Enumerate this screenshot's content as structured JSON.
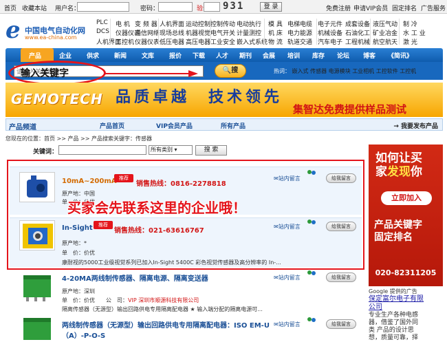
{
  "topbar": {
    "home": "首页",
    "favorite": "收藏本站",
    "username_label": "用户名：",
    "password_label": "密码：",
    "captcha_label": "验证码：",
    "captcha_value": "931",
    "login": "登 录",
    "links": [
      "免费注册",
      "申请VIP会员",
      "固定排名",
      "广告服务"
    ]
  },
  "logo": {
    "mark": "e",
    "name": "中国电气自动化网",
    "url": "www.ea-china.com"
  },
  "categories": {
    "col1": [
      "PLC",
      "DCS",
      "人机界面"
    ],
    "col2": [
      "电 机",
      "仪器仪表",
      "工控机"
    ],
    "col3": [
      "变 频 器",
      "通信网络",
      "仪器仪表"
    ],
    "col4": [
      "人机界面",
      "现场总线",
      "低压电器"
    ],
    "col5": [
      "运动控制",
      "机器视觉",
      "高压电器"
    ],
    "col6": [
      "控制传动",
      "电气开关",
      "工业安全"
    ],
    "col7": [
      "电动执行",
      "计量测控",
      "嵌入式系统"
    ],
    "col8": [
      "模 具",
      "机 床",
      "物 流"
    ],
    "col9": [
      "电梯电缆",
      "电力能源",
      "轨道交通"
    ],
    "col10": [
      "电子元件",
      "机械设备",
      "汽车电子"
    ],
    "col11": [
      "成套设备",
      "石油化工",
      "工程机械"
    ],
    "col12": [
      "液压气动",
      "矿业冶金",
      "航空航天"
    ],
    "col13": [
      "制 冷",
      "水 工 业",
      "激 光"
    ]
  },
  "mainnav": [
    "产品",
    "企业",
    "供求",
    "新闻",
    "文库",
    "报价",
    "下载",
    "人才",
    "期刊",
    "会展",
    "培训",
    "库存",
    "论坛",
    "博客",
    "《简讯》"
  ],
  "search": {
    "placeholder": "请输入关键字",
    "button": "搜",
    "hot_label": "热词：",
    "hot_words": [
      "嵌入式",
      "传感器",
      "电源模块",
      "工业相机",
      "工控软件",
      "工控机"
    ]
  },
  "annotation": {
    "oval_text": "输入关键字",
    "overlay_text": "买家会先联系这里的企业哦！"
  },
  "banner": {
    "brand": "GEMOTECH",
    "slogan": "品质卓越　技术领先",
    "sub": "集智达免费提供样品测试"
  },
  "channel": {
    "title": "产品频道",
    "tabs": [
      "产品首页",
      "VIP会员产品",
      "所有产品"
    ],
    "right": "→ 我要发布产品"
  },
  "breadcrumb": "您现在的位置：首页 >> 产品 >> 产品搜索关键字：传感器",
  "kwsearch": {
    "label": "关键词：",
    "select": "所有类别",
    "button": "搜 索"
  },
  "products": [
    {
      "title": "10mA~200mA",
      "badge": "推荐",
      "hotline_label": "销售热线：",
      "hotline": "0816-2278818",
      "origin": "原产地：中国",
      "price": "单　价：价优",
      "message": "站内留言",
      "chat": "给我留言"
    },
    {
      "title": "In-Sight",
      "badge": "推荐",
      "hotline_label": "销售热线：",
      "hotline": "021-63616767",
      "origin": "原产地：*",
      "price": "单　价：价优",
      "desc": "康耐视的5000工业级视觉系列已加入In-Sight 5400C 彩色视觉传感器及高分辨率的 In-...",
      "message": "站内留言",
      "chat": "给我留言"
    },
    {
      "title": "4-20MA两线制传感器、隔离电源、隔离变送器",
      "origin": "原产地：深圳",
      "price": "单　价：价优",
      "company_label": "公　司：",
      "company": "VIP 深圳市顺源科技有限公司",
      "desc": "隔离传感器（无源型）输出回路供电专用隔离配电器 ★ 输入端分配的隔离电源可...",
      "message": "站内留言",
      "chat": "给我留言"
    },
    {
      "title": "两线制传感器（无源型）输出回路供电专用隔离配电器：ISO EM-U",
      "title2": "（A）-P-O-S",
      "message": "站内留言",
      "chat": "给我留言"
    }
  ],
  "ad": {
    "q1": "如何让买",
    "q2a": "家",
    "q2b": "发现",
    "q2c": "你",
    "button": "立即加入",
    "kw1": "产品关键字",
    "kw2": "固定排名",
    "phone": "020-82311205"
  },
  "google": {
    "label": "Google 提供的广告",
    "link1": "保定富尔电子有限",
    "link2": "公司",
    "text": [
      "专业生产各种电感",
      "器，借鉴了国外同",
      "类 产品的设计思",
      "想，质量可靠，择"
    ]
  }
}
